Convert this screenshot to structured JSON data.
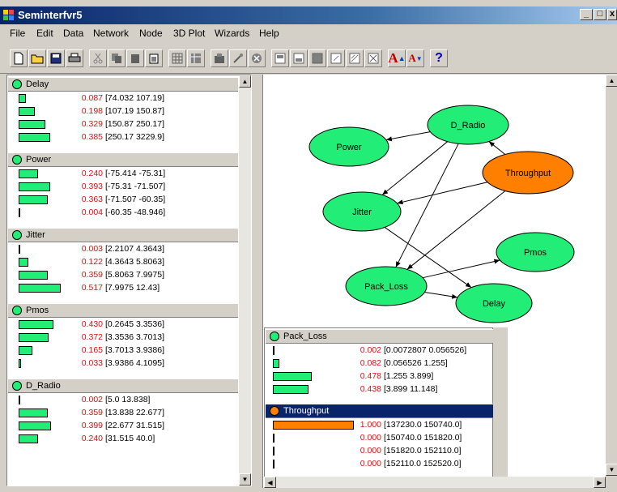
{
  "window": {
    "title": "Seminterfvr5",
    "min_label": "_",
    "max_label": "□",
    "close_label": "x"
  },
  "menu": [
    "File",
    "Edit",
    "Data",
    "Network",
    "Node",
    "3D Plot",
    "Wizards",
    "Help"
  ],
  "toolbar": [
    "new-doc-icon",
    "open-folder-icon",
    "save-icon",
    "print-icon",
    "cut-icon",
    "copy-icon",
    "paste-icon",
    "clipboard-icon",
    "grid-icon",
    "table-icon",
    "node-icon",
    "wand-icon",
    "stop-icon",
    "view1-icon",
    "view2-icon",
    "view3-icon",
    "view4-icon",
    "view5-icon",
    "view6-icon",
    "font-larger-icon",
    "font-smaller-icon",
    "help-icon"
  ],
  "toolbar_text": {
    "font_larger": "A",
    "font_smaller": "A",
    "help": "?"
  },
  "left_nodes": [
    {
      "name": "Delay",
      "states": [
        {
          "p": "0.087",
          "range": "[74.032 107.19]",
          "v": 0.087
        },
        {
          "p": "0.198",
          "range": "[107.19 150.87]",
          "v": 0.198
        },
        {
          "p": "0.329",
          "range": "[150.87 250.17]",
          "v": 0.329
        },
        {
          "p": "0.385",
          "range": "[250.17 3229.9]",
          "v": 0.385
        }
      ]
    },
    {
      "name": "Power",
      "states": [
        {
          "p": "0.240",
          "range": "[-75.414 -75.31]",
          "v": 0.24
        },
        {
          "p": "0.393",
          "range": "[-75.31 -71.507]",
          "v": 0.393
        },
        {
          "p": "0.363",
          "range": "[-71.507 -60.35]",
          "v": 0.363
        },
        {
          "p": "0.004",
          "range": "[-60.35 -48.946]",
          "v": 0.004
        }
      ]
    },
    {
      "name": "Jitter",
      "states": [
        {
          "p": "0.003",
          "range": "[2.2107 4.3643]",
          "v": 0.003
        },
        {
          "p": "0.122",
          "range": "[4.3643 5.8063]",
          "v": 0.122
        },
        {
          "p": "0.359",
          "range": "[5.8063 7.9975]",
          "v": 0.359
        },
        {
          "p": "0.517",
          "range": "[7.9975 12.43]",
          "v": 0.517
        }
      ]
    },
    {
      "name": "Pmos",
      "states": [
        {
          "p": "0.430",
          "range": "[0.2645 3.3536]",
          "v": 0.43
        },
        {
          "p": "0.372",
          "range": "[3.3536 3.7013]",
          "v": 0.372
        },
        {
          "p": "0.165",
          "range": "[3.7013 3.9386]",
          "v": 0.165
        },
        {
          "p": "0.033",
          "range": "[3.9386 4.1095]",
          "v": 0.033
        }
      ]
    },
    {
      "name": "D_Radio",
      "states": [
        {
          "p": "0.002",
          "range": "[5.0 13.838]",
          "v": 0.002
        },
        {
          "p": "0.359",
          "range": "[13.838 22.677]",
          "v": 0.359
        },
        {
          "p": "0.399",
          "range": "[22.677 31.515]",
          "v": 0.399
        },
        {
          "p": "0.240",
          "range": "[31.515 40.0]",
          "v": 0.24
        }
      ]
    }
  ],
  "graph": {
    "nodes": [
      {
        "id": "D_Radio",
        "label": "D_Radio",
        "color": "#22ee77"
      },
      {
        "id": "Power",
        "label": "Power",
        "color": "#22ee77"
      },
      {
        "id": "Throughput",
        "label": "Throughput",
        "color": "#ff8000"
      },
      {
        "id": "Jitter",
        "label": "Jitter",
        "color": "#22ee77"
      },
      {
        "id": "Pmos",
        "label": "Pmos",
        "color": "#22ee77"
      },
      {
        "id": "Pack_Loss",
        "label": "Pack_Loss",
        "color": "#22ee77"
      },
      {
        "id": "Delay",
        "label": "Delay",
        "color": "#22ee77"
      }
    ],
    "edges": [
      [
        "D_Radio",
        "Power"
      ],
      [
        "D_Radio",
        "Jitter"
      ],
      [
        "D_Radio",
        "Pack_Loss"
      ],
      [
        "Throughput",
        "D_Radio"
      ],
      [
        "Throughput",
        "Jitter"
      ],
      [
        "Throughput",
        "Pack_Loss"
      ],
      [
        "Jitter",
        "Delay"
      ],
      [
        "Pack_Loss",
        "Pmos"
      ],
      [
        "Pack_Loss",
        "Delay"
      ]
    ]
  },
  "right_nodes": [
    {
      "name": "Pack_Loss",
      "selected": false,
      "states": [
        {
          "p": "0.002",
          "range": "[0.0072807 0.056526]",
          "v": 0.002
        },
        {
          "p": "0.082",
          "range": "[0.056526 1.255]",
          "v": 0.082
        },
        {
          "p": "0.478",
          "range": "[1.255 3.899]",
          "v": 0.478
        },
        {
          "p": "0.438",
          "range": "[3.899 11.148]",
          "v": 0.438
        }
      ]
    },
    {
      "name": "Throughput",
      "selected": true,
      "states": [
        {
          "p": "1.000",
          "range": "[137230.0 150740.0]",
          "v": 1.0
        },
        {
          "p": "0.000",
          "range": "[150740.0 151820.0]",
          "v": 0.0
        },
        {
          "p": "0.000",
          "range": "[151820.0 152110.0]",
          "v": 0.0
        },
        {
          "p": "0.000",
          "range": "[152110.0 152520.0]",
          "v": 0.0
        }
      ]
    }
  ]
}
